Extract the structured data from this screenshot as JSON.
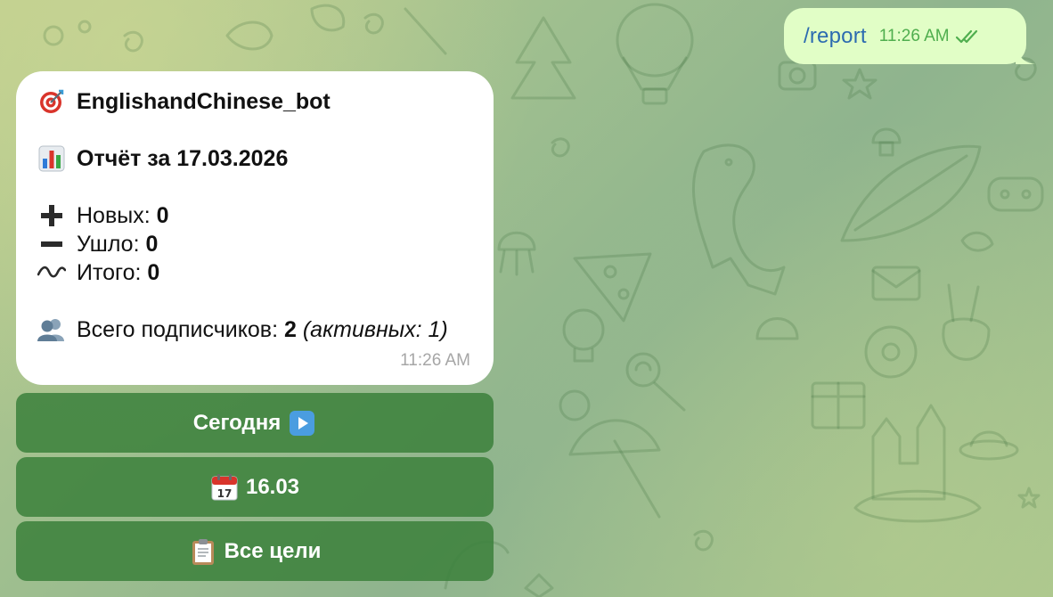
{
  "outgoing": {
    "text": "/report",
    "time": "11:26 AM",
    "status_icon": "double-check-read-icon"
  },
  "report": {
    "bot_icon": "target-emoji",
    "bot_name": "EnglishandChinese_bot",
    "title_icon": "bar-chart-emoji",
    "title": "Отчёт за 17.03.2026",
    "new_icon": "plus-emoji",
    "new_label": "Новых:",
    "new_value": "0",
    "left_icon": "minus-emoji",
    "left_label": "Ушло:",
    "left_value": "0",
    "total_icon": "wavy-dash-emoji",
    "total_label": "Итого:",
    "total_value": "0",
    "subs_icon": "people-emoji",
    "subs_label": "Всего подписчиков:",
    "subs_value": "2",
    "active_text": "(активных: 1)",
    "time": "11:26 AM"
  },
  "keyboard": [
    {
      "label": "Сегодня",
      "icon": "play-button-emoji"
    },
    {
      "label": "16.03",
      "icon": "calendar-emoji"
    },
    {
      "label": "Все цели",
      "icon": "clipboard-emoji"
    }
  ],
  "colors": {
    "outgoing_bubble": "#e1fec6",
    "incoming_bubble": "#ffffff",
    "keyboard_button": "#3e823e",
    "link_text": "#2c6bb0",
    "read_check": "#4fae4e"
  }
}
